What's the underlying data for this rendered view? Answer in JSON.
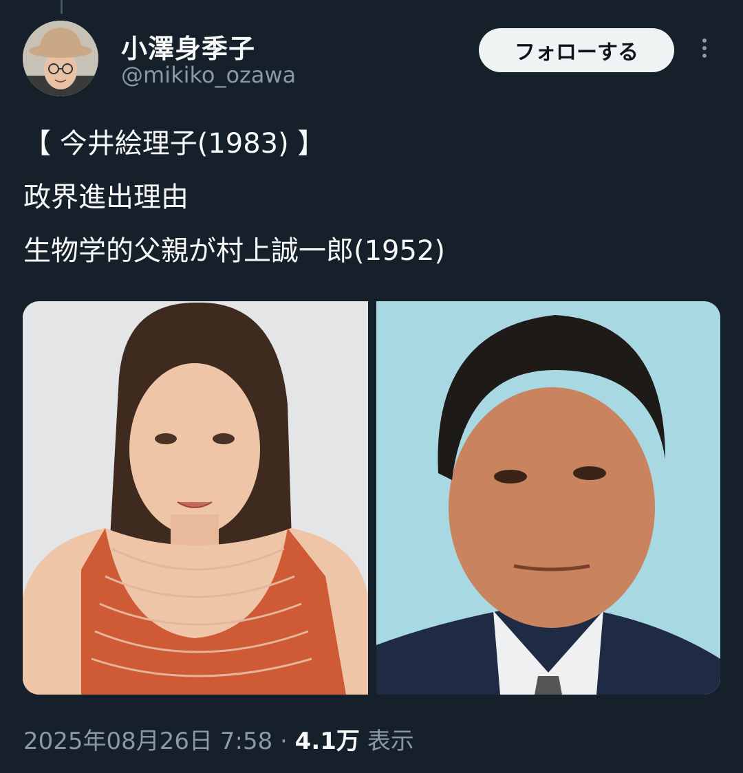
{
  "tweet": {
    "author": {
      "display_name": "小澤身季子",
      "handle": "@mikiko_ozawa"
    },
    "follow_label": "フォローする",
    "text_lines": [
      "【 今井絵理子(1983) 】",
      "政界進出理由",
      "生物学的父親が村上誠一郎(1952)"
    ],
    "timestamp": "2025年08月26日 7:58",
    "separator": "·",
    "view_count": "4.1万",
    "view_label": "表示"
  },
  "colors": {
    "background": "#15202b",
    "text_primary": "#f7f9f9",
    "text_secondary": "#8b98a5",
    "follow_button_bg": "#eff3f4"
  },
  "icons": {
    "more": "more-vertical-icon"
  }
}
